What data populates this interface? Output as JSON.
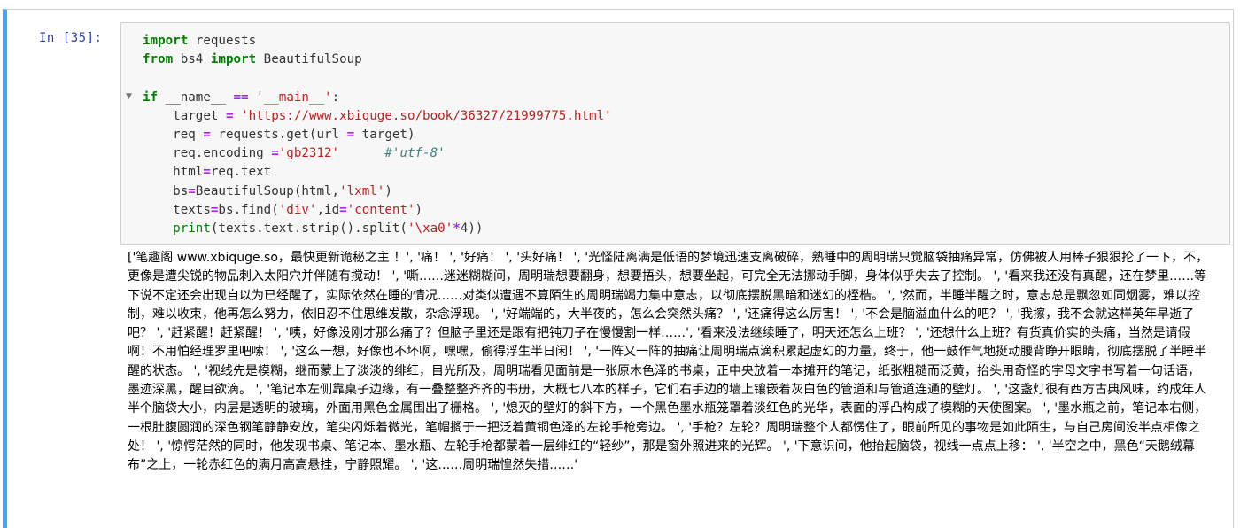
{
  "cell": {
    "prompt": "In  [35]:",
    "code_lines": [
      [
        {
          "t": "import",
          "c": "kw"
        },
        {
          "t": " requests",
          "c": ""
        }
      ],
      [
        {
          "t": "from",
          "c": "kw"
        },
        {
          "t": " bs4 ",
          "c": ""
        },
        {
          "t": "import",
          "c": "kw"
        },
        {
          "t": " BeautifulSoup",
          "c": ""
        }
      ],
      [],
      [
        {
          "t": "if",
          "c": "kw"
        },
        {
          "t": " __name__ ",
          "c": ""
        },
        {
          "t": "==",
          "c": "op"
        },
        {
          "t": " ",
          "c": ""
        },
        {
          "t": "'__main__'",
          "c": "str"
        },
        {
          "t": ":",
          "c": ""
        }
      ],
      [
        {
          "t": "    target ",
          "c": ""
        },
        {
          "t": "=",
          "c": "op"
        },
        {
          "t": " ",
          "c": ""
        },
        {
          "t": "'https://www.xbiquge.so/book/36327/21999775.html'",
          "c": "str"
        }
      ],
      [
        {
          "t": "    req ",
          "c": ""
        },
        {
          "t": "=",
          "c": "op"
        },
        {
          "t": " requests.get(url ",
          "c": ""
        },
        {
          "t": "=",
          "c": "op"
        },
        {
          "t": " target)",
          "c": ""
        }
      ],
      [
        {
          "t": "    req.encoding ",
          "c": ""
        },
        {
          "t": "=",
          "c": "op"
        },
        {
          "t": "'gb2312'",
          "c": "str"
        },
        {
          "t": "      ",
          "c": ""
        },
        {
          "t": "#'utf-8'",
          "c": "cm"
        }
      ],
      [
        {
          "t": "    html",
          "c": ""
        },
        {
          "t": "=",
          "c": "op"
        },
        {
          "t": "req.text",
          "c": ""
        }
      ],
      [
        {
          "t": "    bs",
          "c": ""
        },
        {
          "t": "=",
          "c": "op"
        },
        {
          "t": "BeautifulSoup(html,",
          "c": ""
        },
        {
          "t": "'lxml'",
          "c": "str"
        },
        {
          "t": ")",
          "c": ""
        }
      ],
      [
        {
          "t": "    texts",
          "c": ""
        },
        {
          "t": "=",
          "c": "op"
        },
        {
          "t": "bs.find(",
          "c": ""
        },
        {
          "t": "'div'",
          "c": "str"
        },
        {
          "t": ",id",
          "c": ""
        },
        {
          "t": "=",
          "c": "op"
        },
        {
          "t": "'content'",
          "c": "str"
        },
        {
          "t": ")",
          "c": ""
        }
      ],
      [
        {
          "t": "    ",
          "c": ""
        },
        {
          "t": "print",
          "c": "bi"
        },
        {
          "t": "(texts.text.strip().split(",
          "c": ""
        },
        {
          "t": "'\\xa0'",
          "c": "str"
        },
        {
          "t": "*",
          "c": "op"
        },
        {
          "t": "4",
          "c": ""
        },
        {
          "t": "))",
          "c": ""
        }
      ]
    ],
    "output": "['笔趣阁 www.xbiquge.so，最快更新诡秘之主 ！', '痛！ ', '好痛！ ', '头好痛！ ', '光怪陆离满是低语的梦境迅速支离破碎，熟睡中的周明瑞只觉脑袋抽痛异常，仿佛被人用棒子狠狠抡了一下，不，更像是遭尖锐的物品刺入太阳穴并伴随有搅动！ ', '嘶……迷迷糊糊间，周明瑞想要翻身，想要捂头，想要坐起，可完全无法挪动手脚，身体似乎失去了控制。 ', '看来我还没有真醒，还在梦里……等下说不定还会出现自以为已经醒了，实际依然在睡的情况……对类似遭遇不算陌生的周明瑞竭力集中意志，以彻底摆脱黑暗和迷幻的桎梏。 ', '然而，半睡半醒之时，意志总是飘忽如同烟雾，难以控制，难以收束，他再怎么努力，依旧忍不住思维发散，杂念浮现。 ', '好端端的，大半夜的，怎么会突然头痛？ ', '还痛得这么厉害！ ', '不会是脑溢血什么的吧？ ', '我擦，我不会就这样英年早逝了吧？ ', '赶紧醒！赶紧醒！ ', '咦，好像没刚才那么痛了？但脑子里还是跟有把钝刀子在慢慢割一样……', '看来没法继续睡了，明天还怎么上班？ ', '还想什么上班？有货真价实的头痛，当然是请假啊！不用怕经理罗里吧嗦！ ', '这么一想，好像也不坏啊，嘿嘿，偷得浮生半日闲！ ', '一阵又一阵的抽痛让周明瑞点滴积累起虚幻的力量，终于，他一鼓作气地挺动腰背睁开眼睛，彻底摆脱了半睡半醒的状态。 ', '视线先是模糊，继而蒙上了淡淡的绯红，目光所及，周明瑞看见面前是一张原木色泽的书桌，正中央放着一本摊开的笔记，纸张粗糙而泛黄，抬头用奇怪的字母文字书写着一句话语，墨迹深黑，醒目欲滴。 ', '笔记本左侧靠桌子边缘，有一叠整整齐齐的书册，大概七八本的样子，它们右手边的墙上镶嵌着灰白色的管道和与管道连通的壁灯。 ', '这盏灯很有西方古典风味，约成年人半个脑袋大小，内层是透明的玻璃，外面用黑色金属围出了栅格。 ', '熄灭的壁灯的斜下方，一个黑色墨水瓶笼罩着淡红色的光华，表面的浮凸构成了模糊的天使图案。 ', '墨水瓶之前，笔记本右侧，一根肚腹圆润的深色钢笔静静安放，笔尖闪烁着微光，笔帽搁于一把泛着黄铜色泽的左轮手枪旁边。 ', '手枪？左轮？周明瑞整个人都愣住了，眼前所见的事物是如此陌生，与自己房间没半点相像之处！ ', '惊愕茫然的同时，他发现书桌、笔记本、墨水瓶、左轮手枪都蒙着一层绯红的“轻纱”，那是窗外照进来的光辉。 ', '下意识间，他抬起脑袋，视线一点点上移： ', '半空之中，黑色“天鹅绒幕布”之上，一轮赤红色的满月高高悬挂，宁静照耀。 ', '这……周明瑞惶然失措……'"
  },
  "colors": {
    "cell_border_accent": "#42a5f5",
    "prompt": "#303f9f",
    "keyword": "#008000",
    "string": "#ba2121",
    "operator": "#aa22ff",
    "comment": "#408080"
  }
}
